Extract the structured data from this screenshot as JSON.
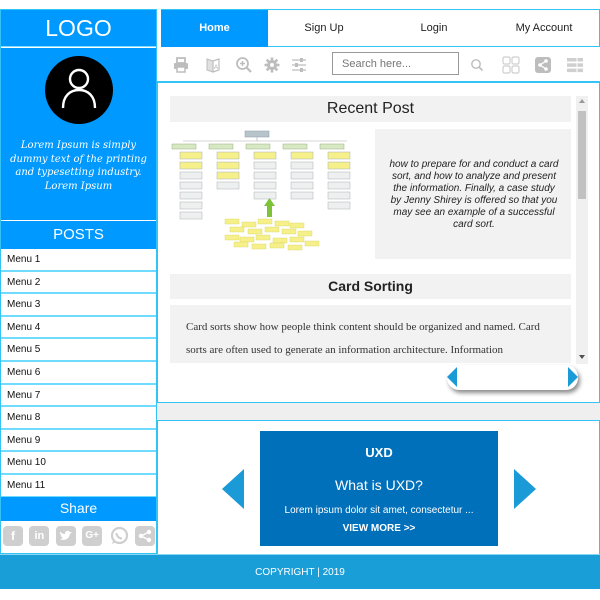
{
  "sidebar": {
    "logo": "LOGO",
    "bio": "Lorem Ipsum is simply dummy text of the printing and typesetting industry. Lorem Ipsum",
    "posts_heading": "POSTS",
    "menu": [
      "Menu 1",
      "Menu 2",
      "Menu 3",
      "Menu 4",
      "Menu 5",
      "Menu 6",
      "Menu 7",
      "Menu 8",
      "Menu 9",
      "Menu 10",
      "Menu 11"
    ],
    "share_heading": "Share",
    "share_icons": [
      "facebook-icon",
      "linkedin-icon",
      "twitter-icon",
      "google-plus-icon",
      "whatsapp-icon",
      "share-icon"
    ]
  },
  "nav": {
    "tabs": [
      {
        "label": "Home",
        "active": true
      },
      {
        "label": "Sign Up",
        "active": false
      },
      {
        "label": "Login",
        "active": false
      },
      {
        "label": "My Account",
        "active": false
      }
    ]
  },
  "toolbar": {
    "icons": [
      "print-icon",
      "translate-icon",
      "zoom-in-icon",
      "gear-icon",
      "sliders-icon"
    ],
    "search_placeholder": "Search here...",
    "right_icons": [
      "search-icon",
      "grid-icon",
      "share-icon",
      "list-icon"
    ]
  },
  "content": {
    "recent_post_heading": "Recent Post",
    "recent_post_text": "how to prepare for and conduct a card sort, and how to analyze and present the information. Finally, a case study by Jenny Shirey is offered so that you may see an example of a successful card sort.",
    "card_sorting_heading": "Card Sorting",
    "card_sorting_text": "Card sorts show how people think content should be organized and named. Card sorts are often used to generate an information architecture. Information"
  },
  "carousel": {
    "title": "UXD",
    "subtitle": "What is UXD?",
    "description": "Lorem ipsum dolor sit amet, consectetur ...",
    "link": "VIEW MORE >>"
  },
  "footer": {
    "text": "COPYRIGHT | 2019"
  },
  "colors": {
    "primary": "#0099ff",
    "border": "#33c3f5",
    "card": "#0070bb",
    "arrow": "#1a9ad6",
    "footer": "#1a9ed8"
  }
}
